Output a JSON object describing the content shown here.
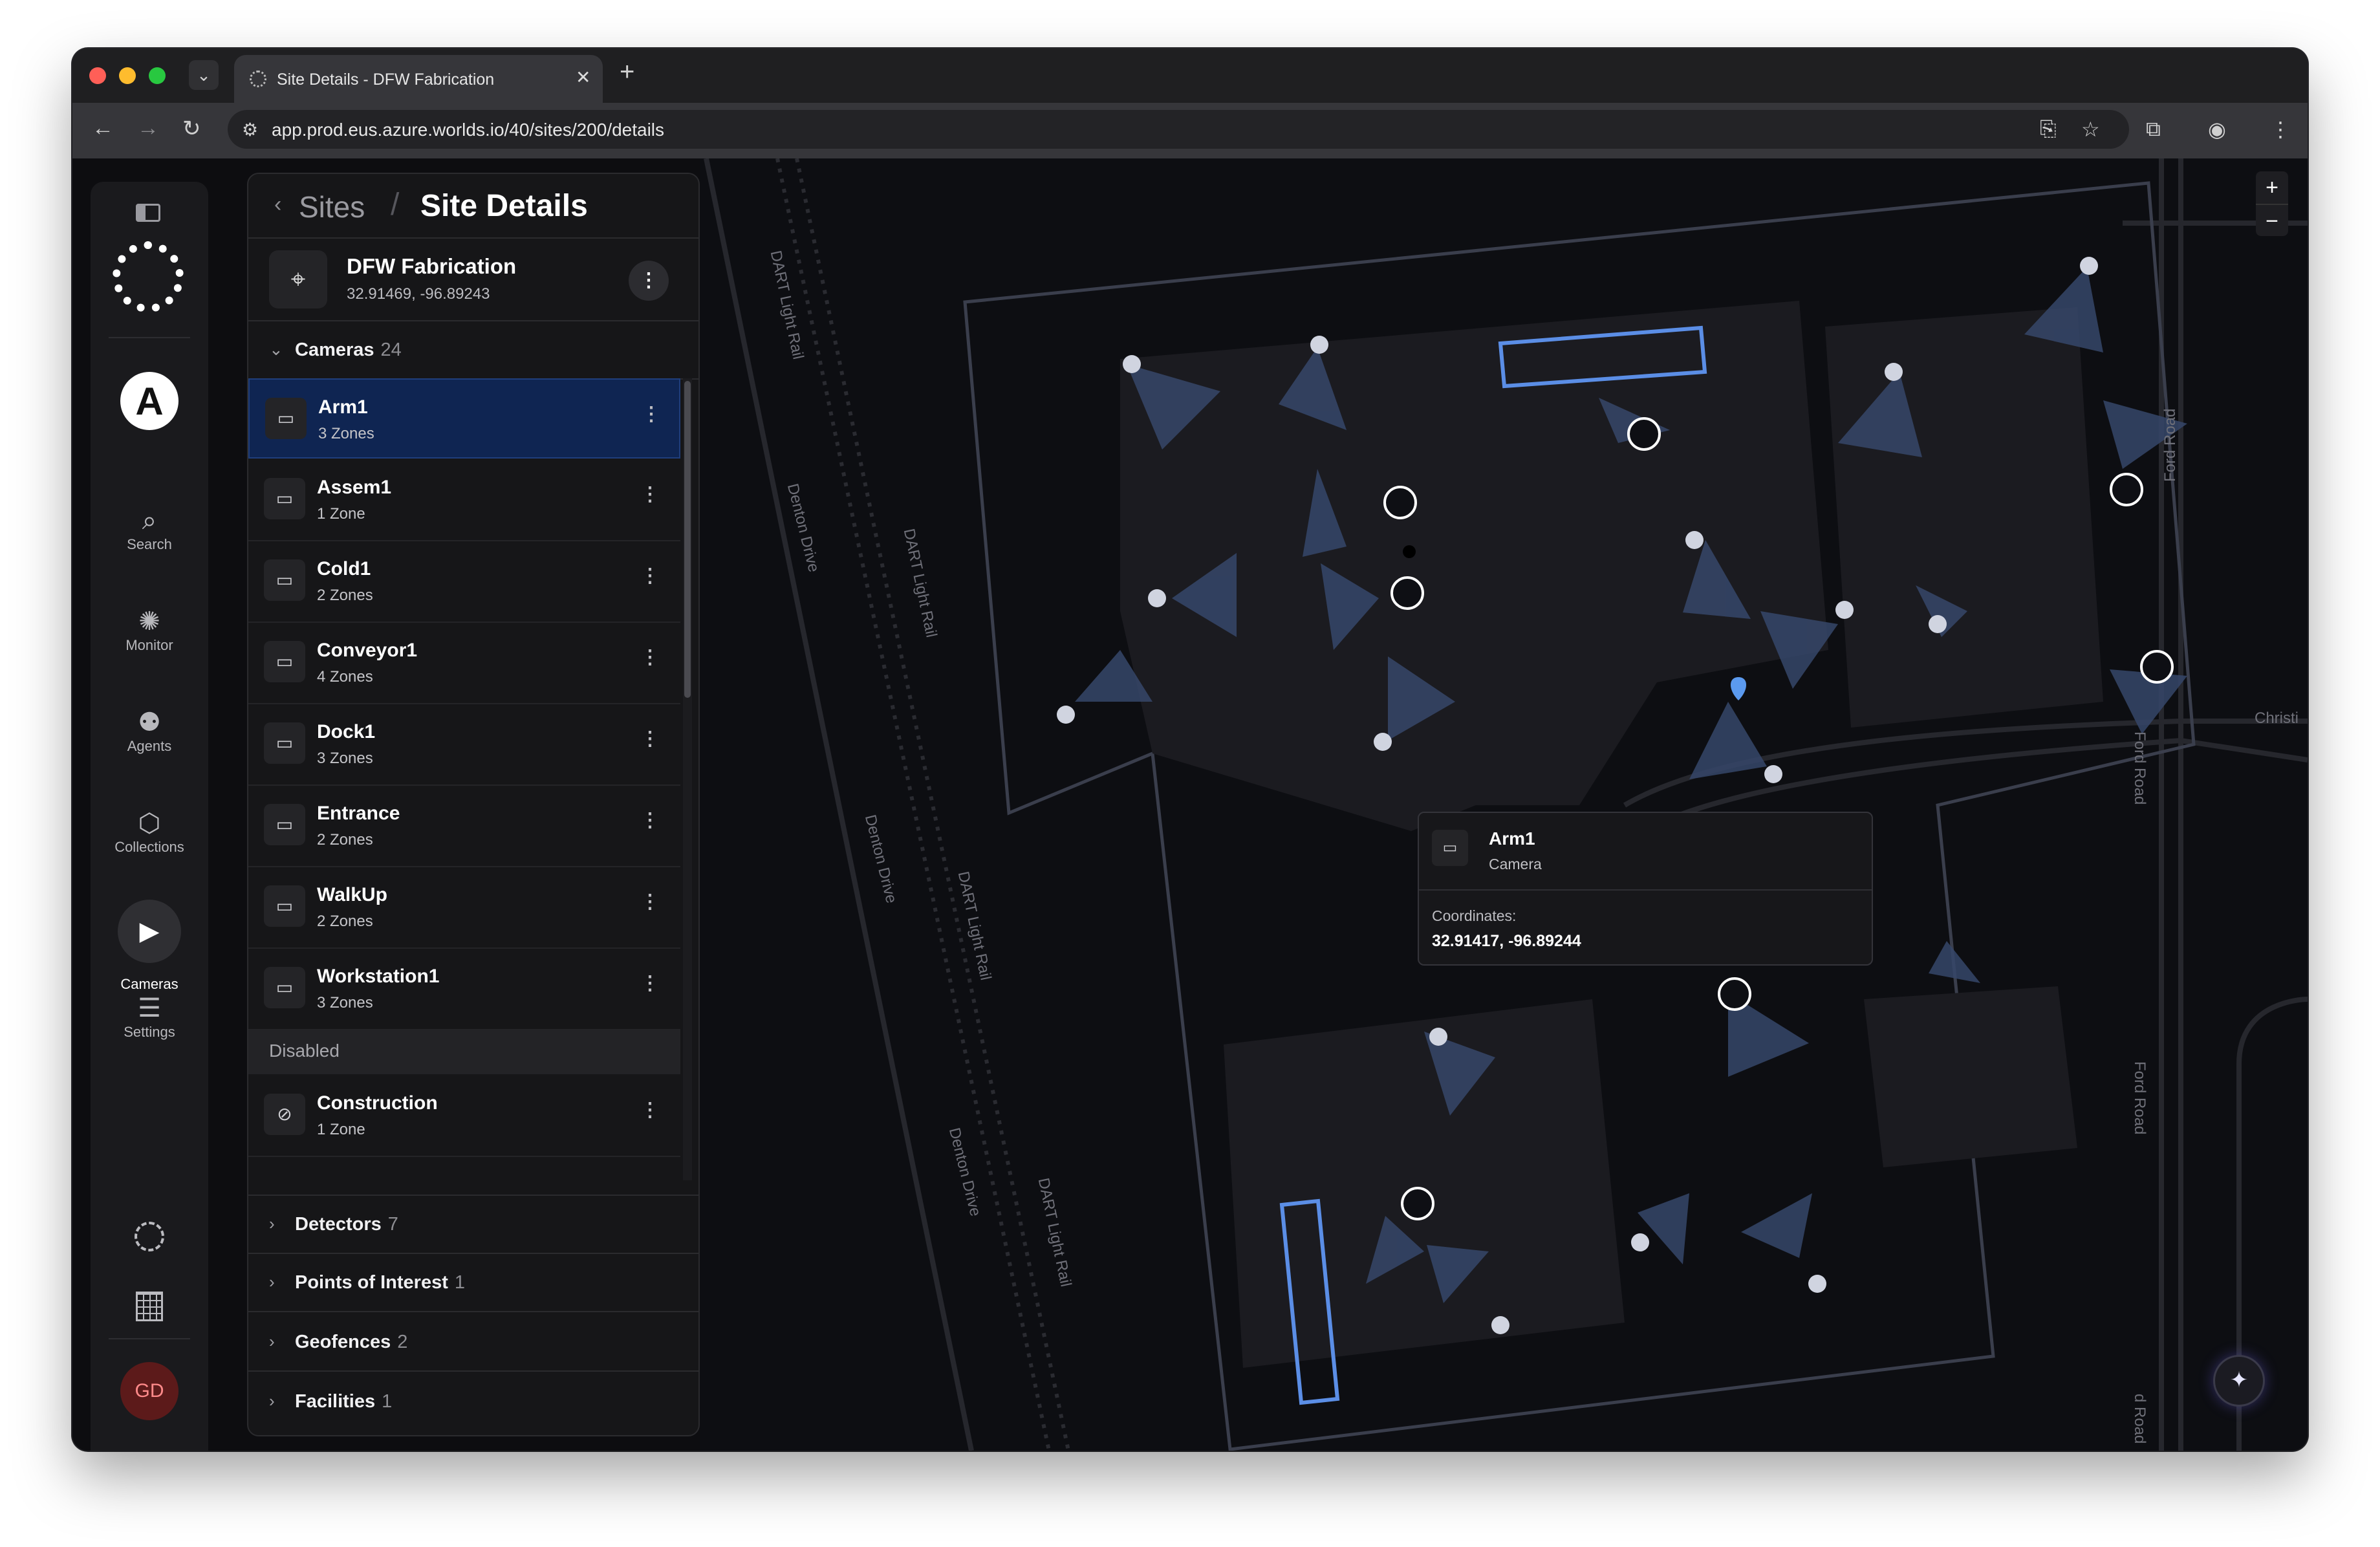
{
  "browser": {
    "tab_title": "Site Details - DFW Fabrication",
    "url": "app.prod.eus.azure.worlds.io/40/sites/200/details"
  },
  "rail": {
    "items": [
      {
        "label": "Search",
        "icon": "search-icon"
      },
      {
        "label": "Monitor",
        "icon": "monitor-icon"
      },
      {
        "label": "Agents",
        "icon": "robot-icon"
      },
      {
        "label": "Collections",
        "icon": "collections-icon"
      },
      {
        "label": "Cameras",
        "icon": "camera-icon"
      },
      {
        "label": "Settings",
        "icon": "sliders-icon"
      }
    ],
    "avatar_initials": "GD"
  },
  "breadcrumb": {
    "parent": "Sites",
    "separator": "/",
    "current": "Site Details"
  },
  "site": {
    "name": "DFW Fabrication",
    "coords": "32.91469, -96.89243"
  },
  "cameras_section": {
    "label": "Cameras",
    "count": "24"
  },
  "cameras": [
    {
      "name": "Arm1",
      "zones": "3 Zones"
    },
    {
      "name": "Assem1",
      "zones": "1 Zone"
    },
    {
      "name": "Cold1",
      "zones": "2 Zones"
    },
    {
      "name": "Conveyor1",
      "zones": "4 Zones"
    },
    {
      "name": "Dock1",
      "zones": "3 Zones"
    },
    {
      "name": "Entrance",
      "zones": "2 Zones"
    },
    {
      "name": "WalkUp",
      "zones": "2 Zones"
    },
    {
      "name": "Workstation1",
      "zones": "3 Zones"
    }
  ],
  "disabled_label": "Disabled",
  "disabled_cameras": [
    {
      "name": "Construction",
      "zones": "1 Zone"
    }
  ],
  "sections": [
    {
      "label": "Detectors",
      "count": "7"
    },
    {
      "label": "Points of Interest",
      "count": "1"
    },
    {
      "label": "Geofences",
      "count": "2"
    },
    {
      "label": "Facilities",
      "count": "1"
    }
  ],
  "map": {
    "streets": {
      "dart_rail_1": "DART Light Rail",
      "dart_rail_2": "DART Light Rail",
      "dart_rail_3": "DART Light Rail",
      "dart_rail_4": "DART Light Rail",
      "denton_1": "Denton Drive",
      "denton_2": "Denton Drive",
      "denton_3": "Denton Drive",
      "ford_1": "Ford Road",
      "ford_2": "Ford Road",
      "ford_3": "Ford Road",
      "ford_4": "d Road",
      "christi": "Christi"
    },
    "zoom_in": "+",
    "zoom_out": "−",
    "camera_color": "#5b7fbf",
    "highlight_color": "#5b8ee6"
  },
  "tooltip": {
    "name": "Arm1",
    "type": "Camera",
    "coords_label": "Coordinates:",
    "coords_value": "32.91417, -96.89244"
  }
}
